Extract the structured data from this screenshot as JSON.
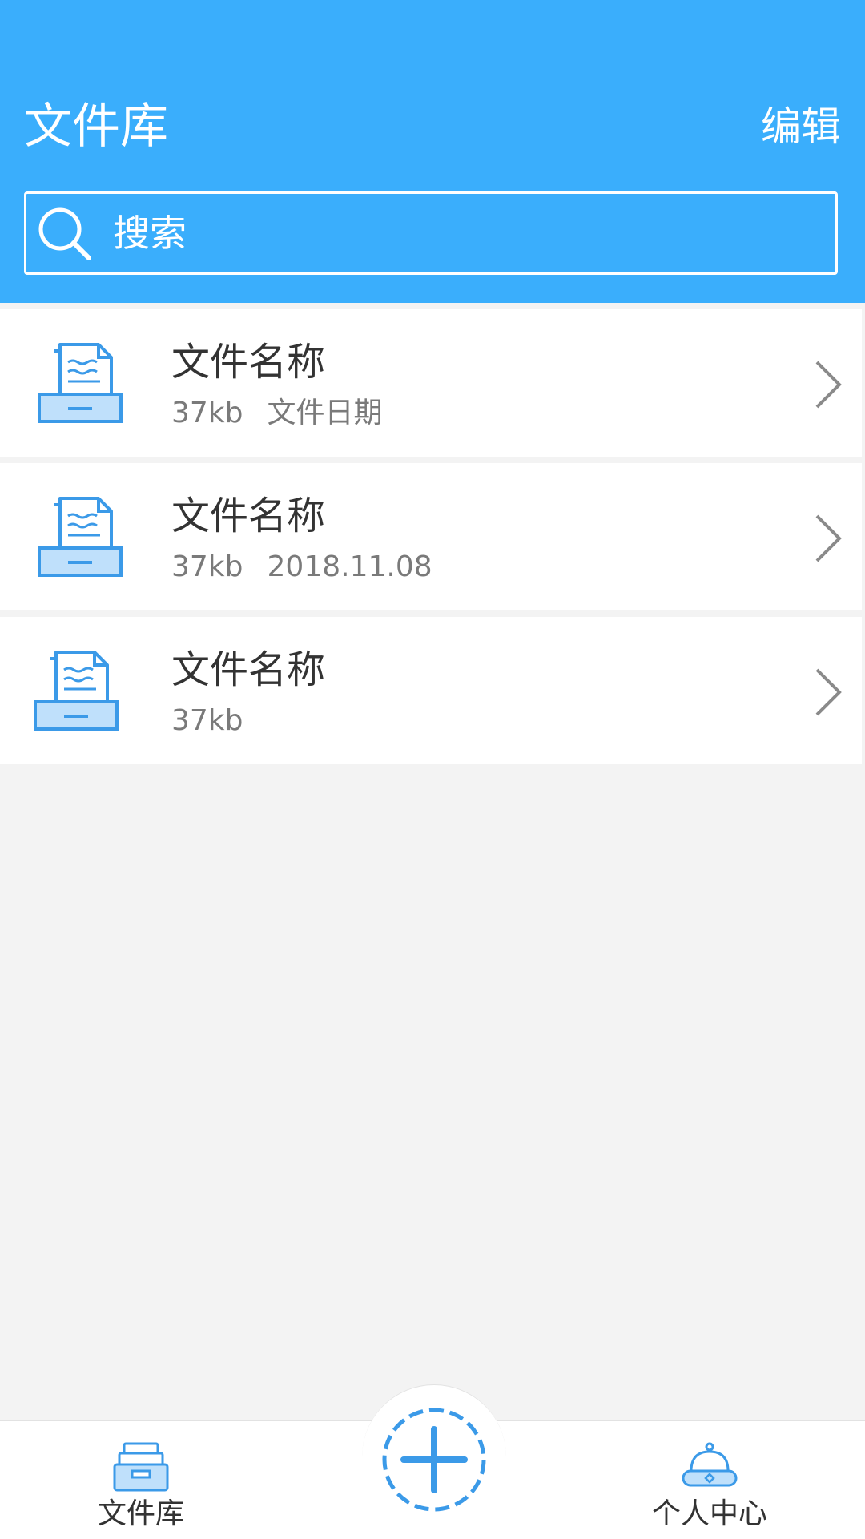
{
  "header": {
    "title": "文件库",
    "edit_label": "编辑",
    "search_placeholder": "搜索"
  },
  "files": [
    {
      "name": "文件名称",
      "size": "37kb",
      "date": "文件日期"
    },
    {
      "name": "文件名称",
      "size": "37kb",
      "date": "2018.11.08"
    },
    {
      "name": "文件名称",
      "size": "37kb",
      "date": ""
    }
  ],
  "tabbar": {
    "files_label": "文件库",
    "add_icon": "plus-icon",
    "profile_label": "个人中心"
  },
  "colors": {
    "primary": "#3aaefc",
    "icon_blue": "#3b9ae8",
    "icon_fill": "#bfe0fb"
  }
}
